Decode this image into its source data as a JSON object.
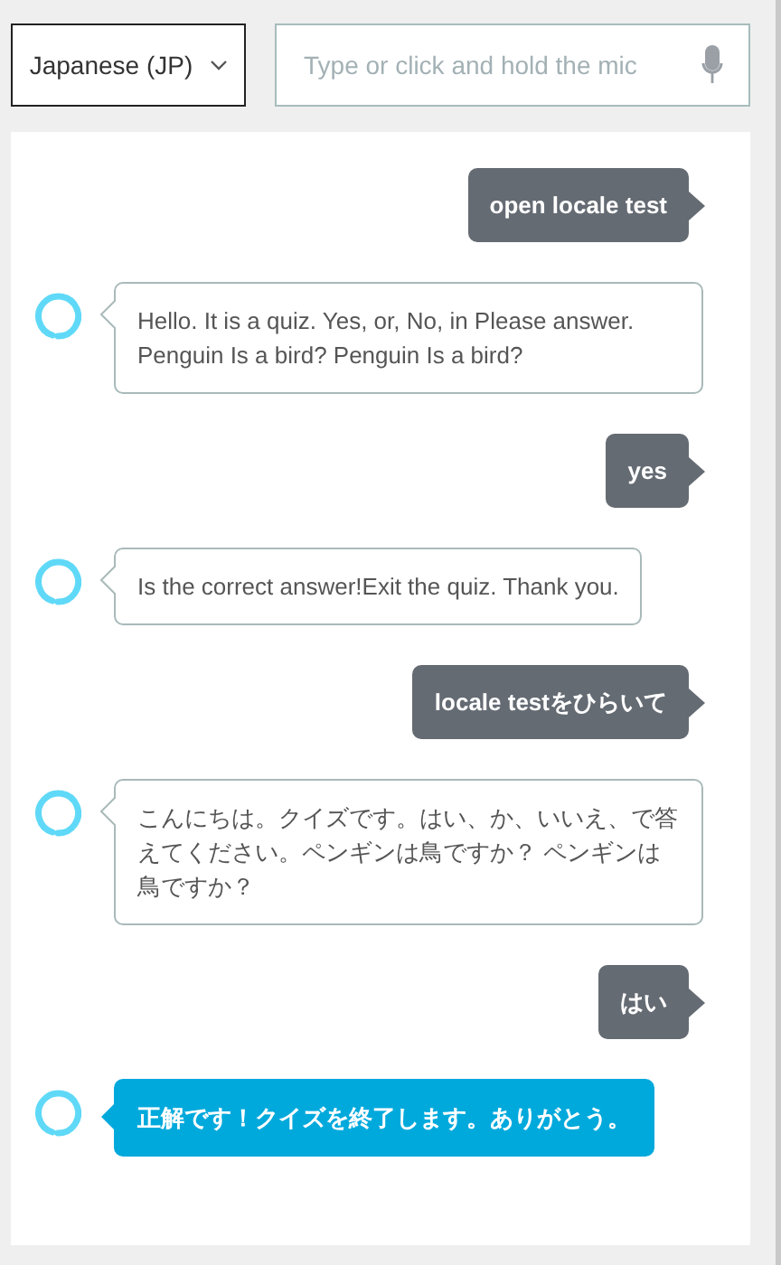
{
  "language_select": {
    "value": "Japanese (JP)"
  },
  "input": {
    "placeholder": "Type or click and hold the mic"
  },
  "messages": [
    {
      "kind": "user",
      "text": "open locale test"
    },
    {
      "kind": "alexa",
      "text": "Hello. It is a quiz. Yes, or, No, in Please answer. Penguin Is a bird? Penguin Is a bird?",
      "highlighted": false
    },
    {
      "kind": "user",
      "text": "yes"
    },
    {
      "kind": "alexa",
      "text": "Is the correct answer!Exit the quiz. Thank you.",
      "highlighted": false
    },
    {
      "kind": "user",
      "text": "locale testをひらいて"
    },
    {
      "kind": "alexa",
      "text": "こんにちは。クイズです。はい、か、いいえ、で答えてください。ペンギンは鳥ですか？ ペンギンは鳥ですか？",
      "highlighted": false
    },
    {
      "kind": "user",
      "text": "はい"
    },
    {
      "kind": "alexa",
      "text": "正解です！クイズを終了します。ありがとう。",
      "highlighted": true
    }
  ]
}
